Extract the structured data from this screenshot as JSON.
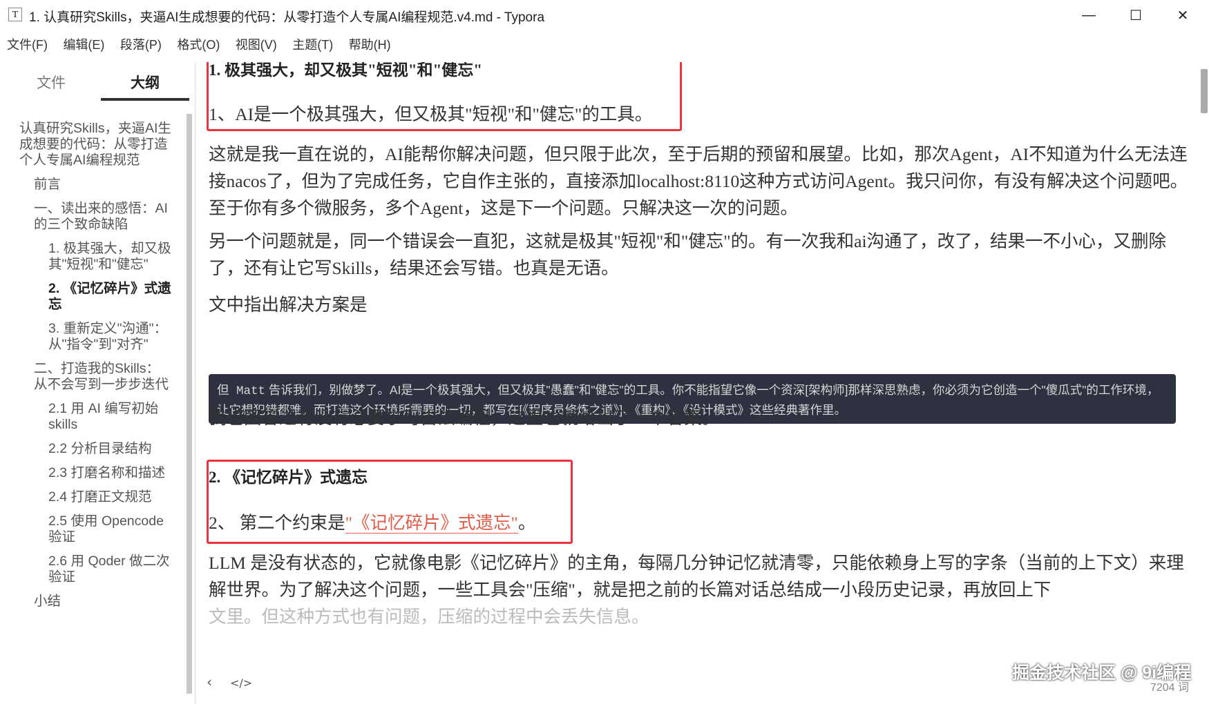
{
  "window": {
    "app_icon": "T",
    "title": "1. 认真研究Skills，夹逼AI生成想要的代码：从零打造个人专属AI编程规范.v4.md - Typora",
    "minimize": "—",
    "maximize": "☐",
    "close": "✕"
  },
  "menu": [
    "文件(F)",
    "编辑(E)",
    "段落(P)",
    "格式(O)",
    "视图(V)",
    "主题(T)",
    "帮助(H)"
  ],
  "sidebar": {
    "tab_files": "文件",
    "tab_outline": "大纲",
    "outline": [
      {
        "label": "认真研究Skills，夹逼AI生成想要的代码：从零打造个人专属AI编程规范",
        "level": 1
      },
      {
        "label": "前言",
        "level": 2
      },
      {
        "label": "一、读出来的感悟：AI 的三个致命缺陷",
        "level": 2
      },
      {
        "label": "1. 极其强大，却又极其\"短视\"和\"健忘\"",
        "level": 3
      },
      {
        "label": "2. 《记忆碎片》式遗忘",
        "level": 3,
        "active": true
      },
      {
        "label": "3. 重新定义\"沟通\"：从\"指令\"到\"对齐\"",
        "level": 3
      },
      {
        "label": "二、打造我的Skills：从不会写到一步步迭代",
        "level": 2
      },
      {
        "label": "2.1 用 AI 编写初始 skills",
        "level": 3
      },
      {
        "label": "2.2 分析目录结构",
        "level": 3
      },
      {
        "label": "2.3 打磨名称和描述",
        "level": 3
      },
      {
        "label": "2.4 打磨正文规范",
        "level": 3
      },
      {
        "label": "2.5 使用 Opencode 验证",
        "level": 3
      },
      {
        "label": "2.6 用 Qoder 做二次验证",
        "level": 3
      },
      {
        "label": "小结",
        "level": 2
      }
    ]
  },
  "content": {
    "h1": "1. 极其强大，却又极其\"短视\"和\"健忘\"",
    "p1": "1、AI是一个极其强大，但又极其\"短视\"和\"健忘\"的工具。",
    "p2": "这就是我一直在说的，AI能帮你解决问题，但只限于此次，至于后期的预留和展望。比如，那次Agent，AI不知道为什么无法连接nacos了，但为了完成任务，它自作主张的，直接添加localhost:8110这种方式访问Agent。我只问你，有没有解决这个问题吧。至于你有多个微服务，多个Agent，这是下一个问题。只解决这一次的问题。",
    "p3": "另一个问题就是，同一个错误会一直犯，这就是极其\"短视\"和\"健忘\"的。有一次我和ai沟通了，改了，结果一不小心，又删除了，还有让它写Skills，结果还会写错。也真是无语。",
    "p4": "文中指出解决方案是",
    "code_prefix": "但 Matt",
    "code_rest": " 告诉我们，别做梦了。AI是一个极其强大，但又极其\"愚蠢\"和\"健忘\"的工具。你不能指望它像一个资深[架构师]那样深思熟虑，你必须为它创造一个\"傻瓜式\"的工作环境，让它想犯错都难。而打造这个环境所需要的一切，都写在[《程序员修炼之道》]、《重构》、《设计模式》这些经典著作里。",
    "p5": "我也回答过有没有必要学习古法编程，这里也就给出了一个答案。",
    "h2": "2. 《记忆碎片》式遗忘",
    "p6_prefix": "2、 第二个约束是",
    "p6_link": "\"《记忆碎片》式遗忘\"",
    "p6_suffix": "。",
    "p7": "LLM 是没有状态的，它就像电影《记忆碎片》的主角，每隔几分钟记忆就清零，只能依赖身上写的字条（当前的上下文）来理解世界。为了解决这个问题，一些工具会\"压缩\"，就是把之前的长篇对话总结成一小段历史记录，再放回上下",
    "p8": "文里。但这种方式也有问题，压缩的过程中会丢失信息。"
  },
  "status": {
    "back_icon": "‹",
    "source_icon": "</>",
    "word_count": "7204 词"
  },
  "watermark": "掘金技术社区 @ 9i编程"
}
